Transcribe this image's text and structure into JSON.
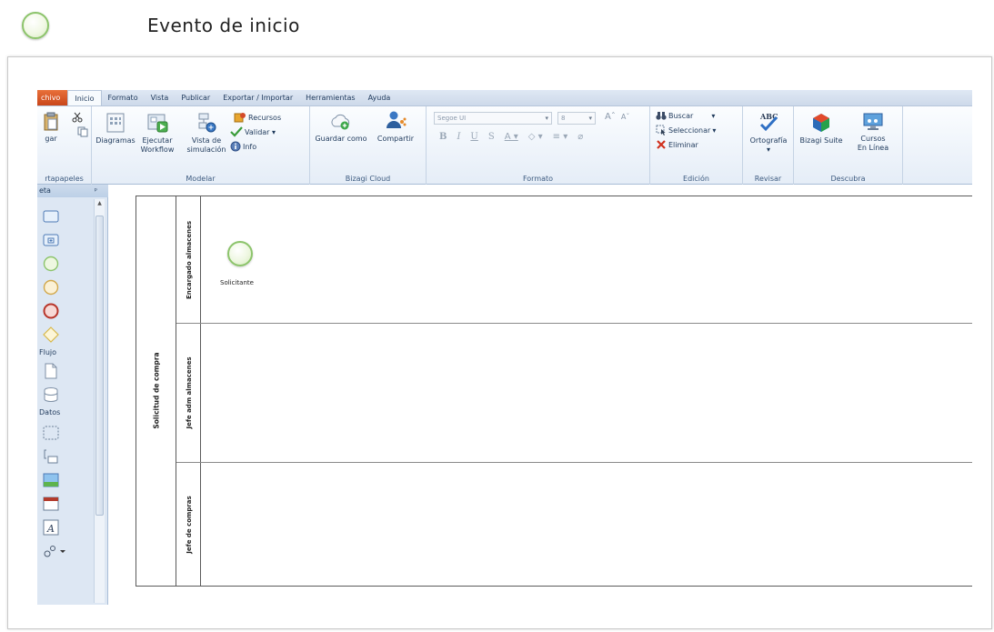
{
  "caption": {
    "title": "Evento de inicio"
  },
  "tabs": [
    "chivo",
    "Inicio",
    "Formato",
    "Vista",
    "Publicar",
    "Exportar / Importar",
    "Herramientas",
    "Ayuda"
  ],
  "ribbon": {
    "clipboard": {
      "paste_label": "gar",
      "group_label": "rtapapeles"
    },
    "modelar": {
      "diagramas": "Diagramas",
      "ejecutar_1": "Ejecutar",
      "ejecutar_2": "Workflow",
      "vista_1": "Vista de",
      "vista_2": "simulación",
      "recursos": "Recursos",
      "validar": "Validar ▾",
      "info": "Info",
      "group_label": "Modelar"
    },
    "cloud": {
      "guardar": "Guardar como",
      "compartir": "Compartir",
      "group_label": "Bizagi Cloud"
    },
    "formato": {
      "font_name": "Segoe UI",
      "font_size": "8",
      "group_label": "Formato"
    },
    "edicion": {
      "buscar": "Buscar",
      "seleccionar": "Seleccionar",
      "eliminar": "Eliminar",
      "group_label": "Edición"
    },
    "revisar": {
      "ortografia": "Ortografía",
      "group_label": "Revisar"
    },
    "descubra": {
      "suite": "Bizagi Suite",
      "cursos_1": "Cursos",
      "cursos_2": "En Línea",
      "group_label": "Descubra"
    }
  },
  "palette": {
    "header": "eta",
    "pin": "ᵖ",
    "flujo": "Flujo",
    "datos": "Datos"
  },
  "diagram": {
    "pool_name": "Solicitud de compra",
    "lanes": [
      {
        "name": "Encargado almacenes"
      },
      {
        "name": "Jefe adm almacenes"
      },
      {
        "name": "Jefe de compras"
      }
    ],
    "start_event_label": "Solicitante"
  }
}
